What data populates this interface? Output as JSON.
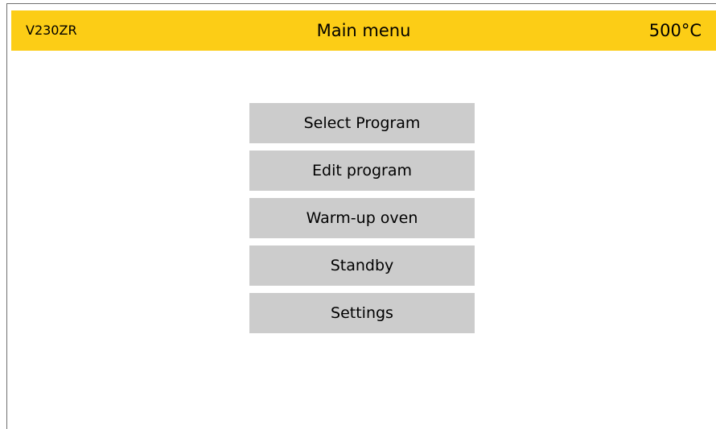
{
  "header": {
    "device_id": "V230ZR",
    "title": "Main menu",
    "temperature": "500°C"
  },
  "menu": {
    "items": [
      {
        "label": "Select Program"
      },
      {
        "label": "Edit program"
      },
      {
        "label": "Warm-up oven"
      },
      {
        "label": "Standby"
      },
      {
        "label": "Settings"
      }
    ]
  },
  "colors": {
    "header_background": "#fccd16",
    "button_background": "#cccccc"
  }
}
